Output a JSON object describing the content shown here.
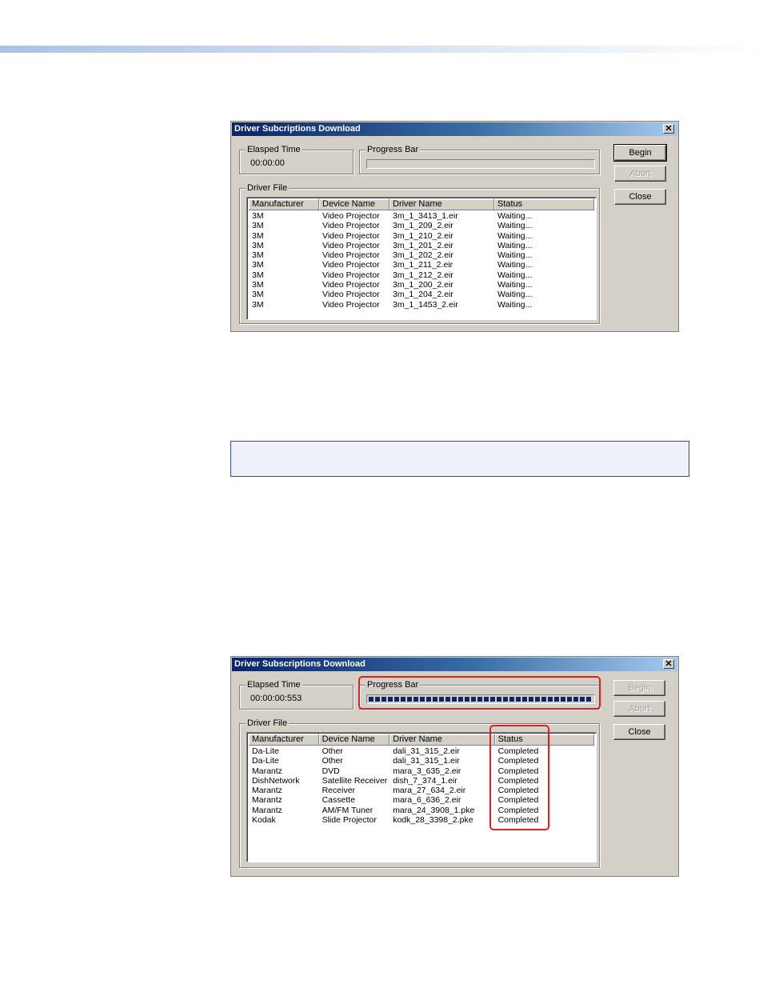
{
  "dialog1": {
    "title": "Driver Subcriptions Download",
    "close_glyph": "✕",
    "elapsed_label": "Elasped Time",
    "elapsed_value": "00:00:00",
    "progress_label": "Progress Bar",
    "progress_fraction": 0,
    "group_label": "Driver File",
    "buttons": {
      "begin": "Begin",
      "abort": "Abort",
      "close": "Close"
    },
    "columns": [
      "Manufacturer",
      "Device Name",
      "Driver Name",
      "Status"
    ],
    "rows": [
      [
        "3M",
        "Video Projector",
        "3m_1_3413_1.eir",
        "Waiting..."
      ],
      [
        "3M",
        "Video Projector",
        "3m_1_209_2.eir",
        "Waiting..."
      ],
      [
        "3M",
        "Video Projector",
        "3m_1_210_2.eir",
        "Waiting..."
      ],
      [
        "3M",
        "Video Projector",
        "3m_1_201_2.eir",
        "Waiting..."
      ],
      [
        "3M",
        "Video Projector",
        "3m_1_202_2.eir",
        "Waiting..."
      ],
      [
        "3M",
        "Video Projector",
        "3m_1_211_2.eir",
        "Waiting..."
      ],
      [
        "3M",
        "Video Projector",
        "3m_1_212_2.eir",
        "Waiting..."
      ],
      [
        "3M",
        "Video Projector",
        "3m_1_200_2.eir",
        "Waiting..."
      ],
      [
        "3M",
        "Video Projector",
        "3m_1_204_2.eir",
        "Waiting..."
      ],
      [
        "3M",
        "Video Projector",
        "3m_1_1453_2.eir",
        "Waiting..."
      ]
    ]
  },
  "dialog2": {
    "title": "Driver Subscriptions Download",
    "close_glyph": "✕",
    "elapsed_label": "Elapsed Time",
    "elapsed_value": "00:00:00:553",
    "progress_label": "Progress Bar",
    "progress_fraction": 1,
    "group_label": "Driver File",
    "buttons": {
      "begin": "Begin",
      "abort": "Abort",
      "close": "Close"
    },
    "columns": [
      "Manufacturer",
      "Device Name",
      "Driver Name",
      "Status"
    ],
    "rows": [
      [
        "Da-Lite",
        "Other",
        "dali_31_315_2.eir",
        "Completed"
      ],
      [
        "Da-Lite",
        "Other",
        "dali_31_315_1.eir",
        "Completed"
      ],
      [
        "Marantz",
        "DVD",
        "mara_3_635_2.eir",
        "Completed"
      ],
      [
        "DishNetwork",
        "Satellite Receiver",
        "dish_7_374_1.eir",
        "Completed"
      ],
      [
        "Marantz",
        "Receiver",
        "mara_27_634_2.eir",
        "Completed"
      ],
      [
        "Marantz",
        "Cassette",
        "mara_6_636_2.eir",
        "Completed"
      ],
      [
        "Marantz",
        "AM/FM Tuner",
        "mara_24_3908_1.pke",
        "Completed"
      ],
      [
        "Kodak",
        "Slide Projector",
        "kodk_28_3398_2.pke",
        "Completed"
      ]
    ]
  },
  "colors": {
    "highlight": "#e02020",
    "progress": "#0a246a",
    "note_border": "#2f4d8f"
  }
}
